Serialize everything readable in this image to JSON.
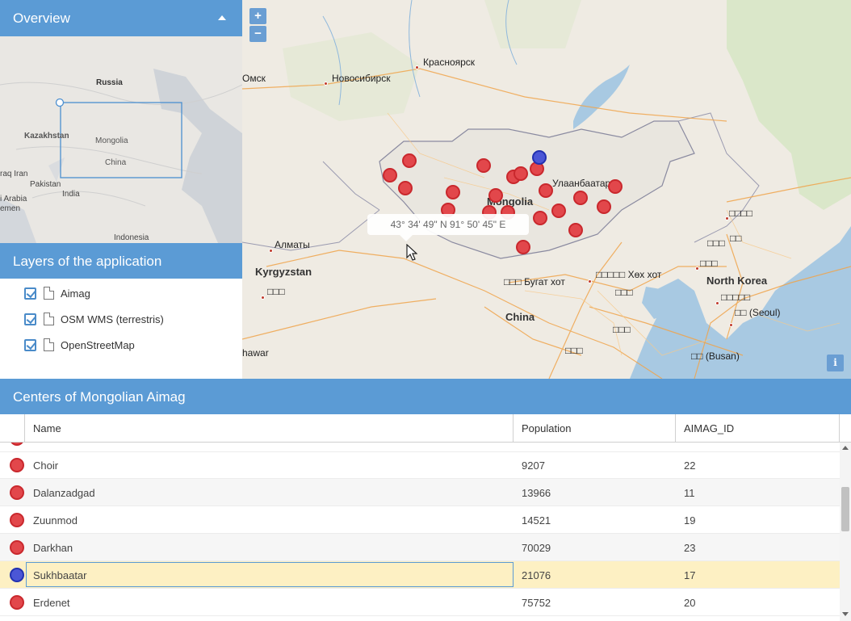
{
  "overview": {
    "title": "Overview",
    "labels": {
      "russia": "Russia",
      "kazakhstan": "Kazakhstan",
      "mongolia": "Mongolia",
      "china": "China",
      "iraq_iran": "raq Iran",
      "pakistan": "Pakistan",
      "india": "India",
      "arabia": "i Arabia",
      "yemen": "emen",
      "indonesia": "Indonesia"
    }
  },
  "layers": {
    "title": "Layers of the application",
    "items": [
      {
        "label": "Aimag",
        "checked": true
      },
      {
        "label": "OSM WMS (terrestris)",
        "checked": true
      },
      {
        "label": "OpenStreetMap",
        "checked": true
      }
    ]
  },
  "map": {
    "zoom_in": "+",
    "zoom_out": "−",
    "info": "i",
    "tooltip": "43° 34' 49\" N 91° 50' 45\" E",
    "labels": {
      "krasnoyarsk": "Красноярск",
      "omsk": "Омск",
      "novosibirsk": "Новосибирск",
      "ulaanbaatar": "Улаанбаатар",
      "mongolia": "Mongolia",
      "almaty": "Алматы",
      "kyrgyzstan": "Kyrgyzstan",
      "bugat": "□□□ Бугат хот",
      "khokh": "□□□□□ Хөх хот",
      "china": "China",
      "north_korea": "North Korea",
      "seoul": "□□ (Seoul)",
      "busan": "□□ (Busan)",
      "hawar": "hawar",
      "cjk1": "□□□□",
      "cjk2": "□□□",
      "cjk3": "□□",
      "cjk4": "□□□",
      "cjk5": "□□□□□",
      "cjk6": "□□□",
      "cjk7": "□□□",
      "cjk8": "□□□",
      "cjk9": "□□□"
    }
  },
  "grid": {
    "title": "Centers of Mongolian Aimag",
    "columns": [
      "Name",
      "Population",
      "AIMAG_ID"
    ],
    "rows": [
      {
        "name": "Choir",
        "population": "9207",
        "aimag_id": "22",
        "selected": false
      },
      {
        "name": "Dalanzadgad",
        "population": "13966",
        "aimag_id": "11",
        "selected": false
      },
      {
        "name": "Zuunmod",
        "population": "14521",
        "aimag_id": "19",
        "selected": false
      },
      {
        "name": "Darkhan",
        "population": "70029",
        "aimag_id": "23",
        "selected": false
      },
      {
        "name": "Sukhbaatar",
        "population": "21076",
        "aimag_id": "17",
        "selected": true
      },
      {
        "name": "Erdenet",
        "population": "75752",
        "aimag_id": "20",
        "selected": false
      }
    ]
  },
  "colors": {
    "header_blue": "#5b9bd5",
    "feature_red": "#e2474b",
    "feature_selected_blue": "#4b56d6",
    "selected_row": "#fdf0c3"
  }
}
